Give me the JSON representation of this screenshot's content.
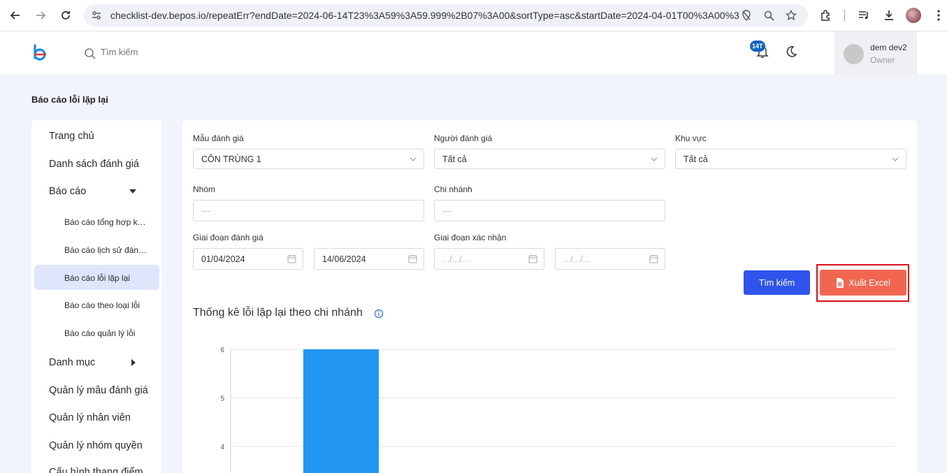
{
  "browser": {
    "url": "checklist-dev.bepos.io/repeatErr?endDate=2024-06-14T23%3A59%3A59.999%2B07%3A00&sortType=asc&startDate=2024-04-01T00%3A00%3..."
  },
  "header": {
    "search_placeholder": "Tìm kiếm",
    "notification_badge": "14T",
    "user_name": "dem dev2",
    "user_role": "Owner"
  },
  "page": {
    "title": "Báo cáo lỗi lặp lại"
  },
  "sidebar": {
    "items": [
      {
        "label": "Trang chủ"
      },
      {
        "label": "Danh sách đánh giá"
      },
      {
        "label": "Báo cáo"
      },
      {
        "label": "Báo cáo tổng hợp kết quả"
      },
      {
        "label": "Báo cáo lịch sử đánh giá"
      },
      {
        "label": "Báo cáo lỗi lặp lại"
      },
      {
        "label": "Báo cáo theo loại lỗi"
      },
      {
        "label": "Báo cáo quản lý lỗi"
      },
      {
        "label": "Danh mục"
      },
      {
        "label": "Quản lý mẫu đánh giá"
      },
      {
        "label": "Quản lý nhân viên"
      },
      {
        "label": "Quản lý nhóm quyền"
      },
      {
        "label": "Cấu hình thang điểm"
      }
    ]
  },
  "filters": {
    "template_label": "Mẫu đánh giá",
    "template_value": "CÔN TRÙNG 1",
    "evaluator_label": "Người đánh giá",
    "evaluator_value": "Tất cả",
    "region_label": "Khu vực",
    "region_value": "Tất cả",
    "group_label": "Nhóm",
    "group_placeholder": "---",
    "branch_label": "Chi nhánh",
    "branch_placeholder": "---",
    "eval_period_label": "Giai đoạn đánh giá",
    "eval_start": "01/04/2024",
    "eval_end": "14/06/2024",
    "confirm_period_label": "Giai đoạn xác nhận",
    "confirm_start_placeholder": ".../.../...",
    "confirm_end_placeholder": ".../.../...",
    "search_button": "Tìm kiếm",
    "export_button": "Xuất Excel"
  },
  "chart_title": "Thống kê lỗi lặp lại theo chi nhánh",
  "colors": {
    "primary": "#2f54eb",
    "export": "#f26650",
    "bar": "#2196f3",
    "highlight": "#d9101a"
  },
  "chart_data": {
    "type": "bar",
    "categories": [
      ""
    ],
    "values": [
      6
    ],
    "title": "Thống kê lỗi lặp lại theo chi nhánh",
    "y_ticks": [
      4,
      5,
      6
    ],
    "ylim_visible": [
      3.5,
      6
    ],
    "grid": true
  }
}
